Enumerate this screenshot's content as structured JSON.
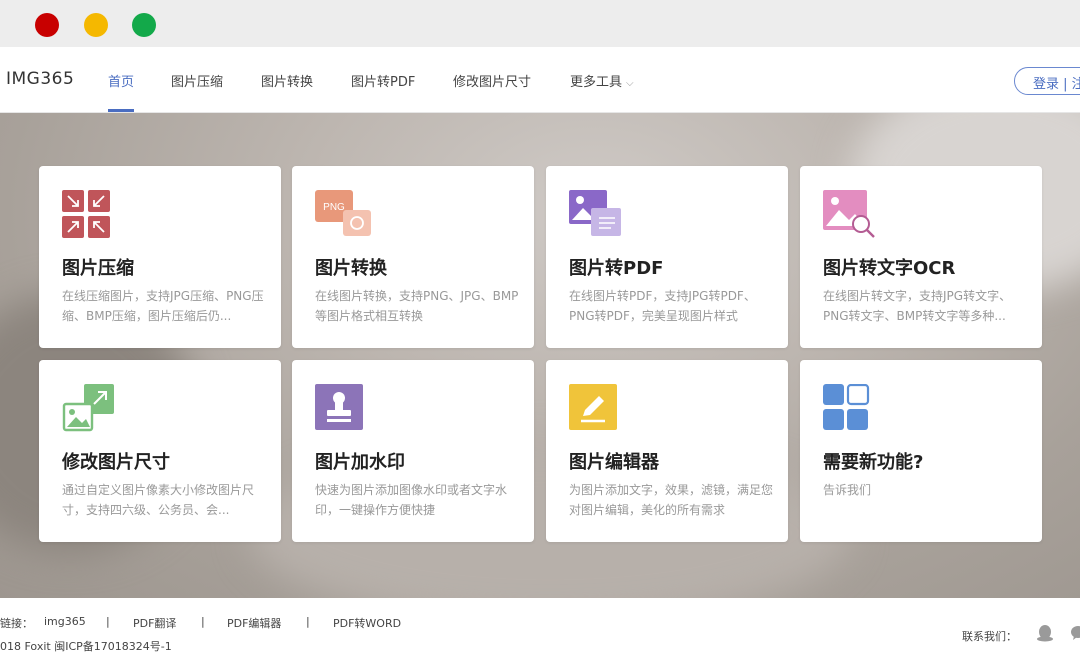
{
  "brand": {
    "logo": "IMG365"
  },
  "nav": {
    "items": [
      "首页",
      "图片压缩",
      "图片转换",
      "图片转PDF",
      "修改图片尺寸",
      "更多工具"
    ],
    "active_index": 0,
    "login_label": "登录 | 注"
  },
  "cards": [
    {
      "title": "图片压缩",
      "desc": "在线压缩图片，支持JPG压缩、PNG压缩、BMP压缩，图片压缩后仍...",
      "icon": "compress-icon",
      "color": "#c0555a"
    },
    {
      "title": "图片转换",
      "desc": "在线图片转换，支持PNG、JPG、BMP等图片格式相互转换",
      "icon": "png-convert-icon",
      "icon_text": "PNG",
      "color": "#e8987a"
    },
    {
      "title": "图片转PDF",
      "desc": "在线图片转PDF，支持JPG转PDF、PNG转PDF，完美呈现图片样式",
      "icon": "image-to-pdf-icon",
      "color": "#8a68c8"
    },
    {
      "title": "图片转文字OCR",
      "desc": "在线图片转文字，支持JPG转文字、PNG转文字、BMP转文字等多种...",
      "icon": "image-ocr-icon",
      "color": "#e38dc0"
    },
    {
      "title": "修改图片尺寸",
      "desc": "通过自定义图片像素大小修改图片尺寸，支持四六级、公务员、会...",
      "icon": "resize-image-icon",
      "color": "#7cc07e"
    },
    {
      "title": "图片加水印",
      "desc": "快速为图片添加图像水印或者文字水印，一键操作方便快捷",
      "icon": "watermark-stamp-icon",
      "color": "#8c74b8"
    },
    {
      "title": "图片编辑器",
      "desc": "为图片添加文字，效果，滤镜，满足您对图片编辑，美化的所有需求",
      "icon": "image-editor-icon",
      "color": "#f0c43a"
    },
    {
      "title": "需要新功能?",
      "desc": "告诉我们",
      "icon": "new-feature-grid-icon",
      "color": "#5b8fd6"
    }
  ],
  "footer": {
    "links_label": "链接：",
    "links": [
      "img365",
      "PDF翻译",
      "PDF编辑器",
      "PDF转WORD"
    ],
    "separator": "|",
    "copyright": "018 Foxit 闽ICP备17018324号-1",
    "contact_label": "联系我们："
  }
}
